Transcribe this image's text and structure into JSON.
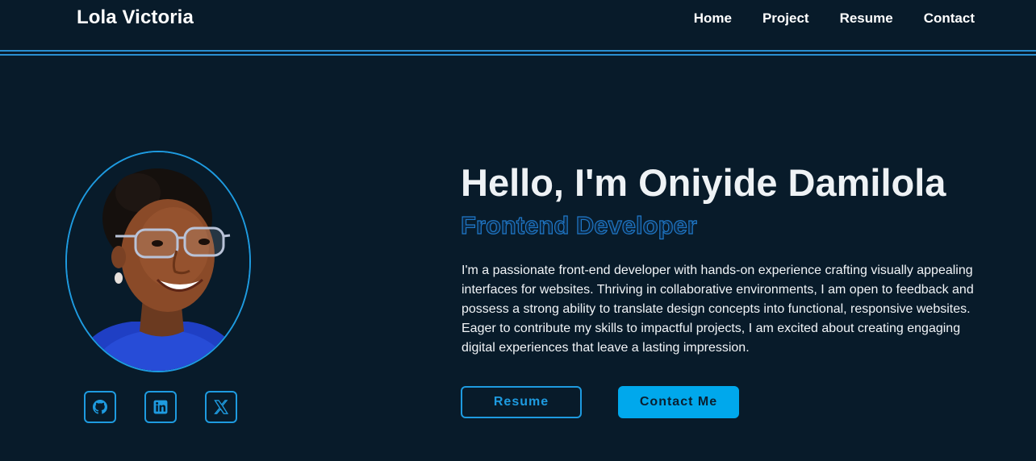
{
  "header": {
    "brand": "Lola Victoria",
    "nav": [
      "Home",
      "Project",
      "Resume",
      "Contact"
    ]
  },
  "hero": {
    "greeting": "Hello, I'm Oniyide Damilola",
    "role": "Frontend Developer",
    "bio": "I'm a passionate front-end developer with hands-on experience crafting visually appealing interfaces for websites. Thriving in collaborative environments, I am open to feedback and possess a strong ability to translate design concepts into functional, responsive websites. Eager to contribute my skills to impactful projects, I am excited about creating engaging digital experiences that leave a lasting impression.",
    "buttons": {
      "resume": "Resume",
      "contact": "Contact Me"
    }
  },
  "socials": [
    {
      "icon": "github-icon"
    },
    {
      "icon": "linkedin-icon"
    },
    {
      "icon": "x-twitter-icon"
    }
  ],
  "colors": {
    "background": "#081b2a",
    "accent": "#1e9be0",
    "button_fill": "#00a8ec"
  }
}
